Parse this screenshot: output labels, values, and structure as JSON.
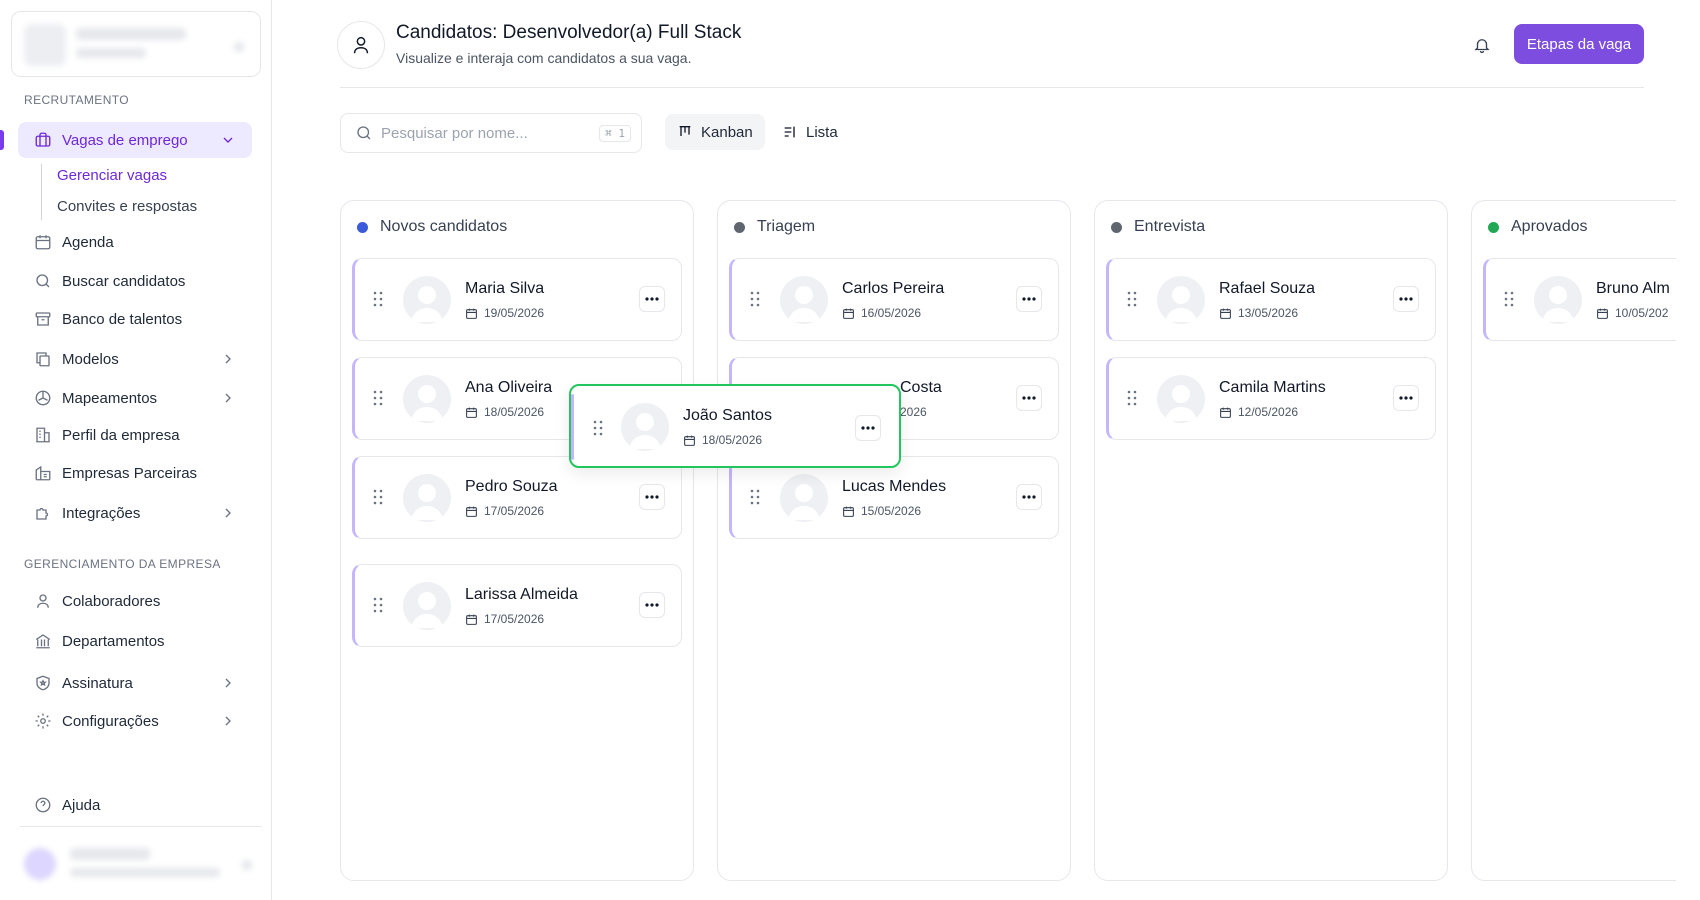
{
  "sidebar": {
    "sections": {
      "recruitment": "RECRUTAMENTO",
      "company": "GERENCIAMENTO DA EMPRESA"
    },
    "jobs": {
      "label": "Vagas de emprego",
      "icon": "briefcase-icon"
    },
    "subitems": [
      {
        "label": "Gerenciar vagas",
        "active": true
      },
      {
        "label": "Convites e respostas",
        "active": false
      }
    ],
    "items": [
      {
        "label": "Agenda",
        "icon": "calendar-icon"
      },
      {
        "label": "Buscar candidatos",
        "icon": "search-icon"
      },
      {
        "label": "Banco de talentos",
        "icon": "archive-icon"
      },
      {
        "label": "Modelos",
        "icon": "copy-icon"
      },
      {
        "label": "Mapeamentos",
        "icon": "gauge-icon"
      },
      {
        "label": "Perfil da empresa",
        "icon": "building-icon"
      },
      {
        "label": "Empresas Parceiras",
        "icon": "buildings-icon"
      },
      {
        "label": "Integrações",
        "icon": "puzzle-icon"
      }
    ],
    "company_items": [
      {
        "label": "Colaboradores",
        "icon": "user-icon"
      },
      {
        "label": "Departamentos",
        "icon": "bank-icon"
      },
      {
        "label": "Assinatura",
        "icon": "shield-icon"
      },
      {
        "label": "Configurações",
        "icon": "gear-icon"
      }
    ],
    "help": "Ajuda"
  },
  "header": {
    "title": "Candidatos: Desenvolvedor(a) Full Stack",
    "subtitle": "Visualize e interaja com candidatos a sua vaga.",
    "action": "Etapas da vaga"
  },
  "toolbar": {
    "search_placeholder": "Pesquisar por nome...",
    "search_value": "",
    "shortcut": "⌘ 1",
    "views": {
      "kanban": "Kanban",
      "list": "Lista"
    },
    "active_view": "kanban"
  },
  "columns": [
    {
      "title": "Novos candidatos",
      "color": "#3b5bdb",
      "cards": [
        {
          "name": "Maria Silva",
          "date": "19/05/2026"
        },
        {
          "name": "Ana Oliveira",
          "date": "18/05/2026"
        },
        {
          "name": "Pedro Souza",
          "date": "17/05/2026"
        },
        {
          "name": "Larissa Almeida",
          "date": "17/05/2026"
        }
      ]
    },
    {
      "title": "Triagem",
      "color": "#5f6670",
      "cards": [
        {
          "name": "Carlos Pereira",
          "date": "16/05/2026"
        },
        {
          "name": "Costa",
          "date": "2026"
        },
        {
          "name": "Lucas Mendes",
          "date": "15/05/2026"
        }
      ]
    },
    {
      "title": "Entrevista",
      "color": "#5f6670",
      "cards": [
        {
          "name": "Rafael Souza",
          "date": "13/05/2026"
        },
        {
          "name": "Camila Martins",
          "date": "12/05/2026"
        }
      ]
    },
    {
      "title": "Aprovados",
      "color": "#22a854",
      "cards": [
        {
          "name": "Bruno Alm",
          "date": "10/05/202"
        }
      ]
    }
  ],
  "dragging": {
    "name": "João Santos",
    "date": "18/05/2026"
  }
}
